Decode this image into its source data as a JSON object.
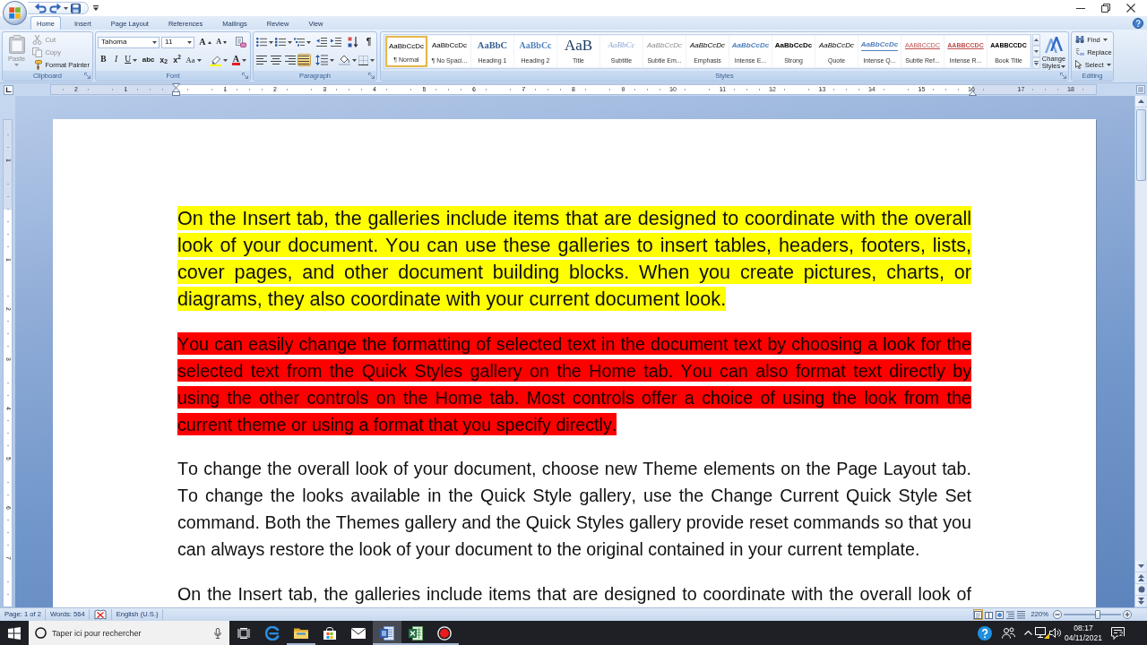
{
  "ribbon": {
    "tabs": [
      {
        "label": "Home",
        "selected": true
      },
      {
        "label": "Insert",
        "selected": false
      },
      {
        "label": "Page Layout",
        "selected": false
      },
      {
        "label": "References",
        "selected": false
      },
      {
        "label": "Mailings",
        "selected": false
      },
      {
        "label": "Review",
        "selected": false
      },
      {
        "label": "View",
        "selected": false
      }
    ],
    "clipboard": {
      "title": "Clipboard",
      "paste": {
        "label": "Paste",
        "disabled": true
      },
      "commands": [
        {
          "kind": "cut",
          "label": "Cut",
          "disabled": true
        },
        {
          "kind": "copy",
          "label": "Copy",
          "disabled": true
        },
        {
          "kind": "format_painter",
          "label": "Format Painter",
          "disabled": false
        }
      ]
    },
    "font": {
      "title": "Font",
      "font_name": "Tahoma",
      "font_size": "11",
      "size_buttons": [
        {
          "kind": "grow",
          "label": "A"
        },
        {
          "kind": "shrink",
          "label": "A"
        }
      ],
      "format_buttons": [
        {
          "kind": "bold",
          "label": "B"
        },
        {
          "kind": "italic",
          "label": "I"
        },
        {
          "kind": "underline",
          "label": "U"
        },
        {
          "kind": "strikethrough",
          "label": "abc"
        },
        {
          "kind": "subscript",
          "label": "x$_{2}$"
        },
        {
          "kind": "superscript",
          "label": "x$^{2}$"
        },
        {
          "kind": "change_case",
          "label": "Aa"
        }
      ],
      "font_color": {
        "label": "A"
      }
    },
    "paragraph": {
      "title": "Paragraph",
      "pilcrow": "¶",
      "alignment": [
        {
          "kind": "left",
          "selected": false
        },
        {
          "kind": "center",
          "selected": false
        },
        {
          "kind": "right",
          "selected": false
        },
        {
          "kind": "justify",
          "selected": true
        }
      ]
    },
    "styles": {
      "title": "Styles",
      "items": [
        {
          "kind": "normal",
          "preview": "AaBbCcDc",
          "label": "¶ Normal",
          "selected": true
        },
        {
          "kind": "no_spacing",
          "preview": "AaBbCcDc",
          "label": "¶ No Spaci...",
          "selected": false
        },
        {
          "kind": "heading1",
          "preview": "AaBbC",
          "label": "Heading 1",
          "selected": false
        },
        {
          "kind": "heading2",
          "preview": "AaBbCc",
          "label": "Heading 2",
          "selected": false
        },
        {
          "kind": "title",
          "preview": "AaB",
          "label": "Title",
          "selected": false
        },
        {
          "kind": "subtitle",
          "preview": "AaBbCc",
          "label": "Subtitle",
          "selected": false
        },
        {
          "kind": "subtle_emphasis",
          "preview": "AaBbCcDc",
          "label": "Subtle Em...",
          "selected": false
        },
        {
          "kind": "emphasis",
          "preview": "AaBbCcDc",
          "label": "Emphasis",
          "selected": false
        },
        {
          "kind": "intense_emphasis",
          "preview": "AaBbCcDc",
          "label": "Intense E...",
          "selected": false
        },
        {
          "kind": "strong",
          "preview": "AaBbCcDc",
          "label": "Strong",
          "selected": false
        },
        {
          "kind": "quote",
          "preview": "AaBbCcDc",
          "label": "Quote",
          "selected": false
        },
        {
          "kind": "intense_quote",
          "preview": "AaBbCcDc",
          "label": "Intense Q...",
          "selected": false
        },
        {
          "kind": "subtle_reference",
          "preview": "AABBCCDC",
          "label": "Subtle Ref...",
          "selected": false
        },
        {
          "kind": "intense_reference",
          "preview": "AABBCCDC",
          "label": "Intense R...",
          "selected": false
        },
        {
          "kind": "book_title",
          "preview": "AABBCCDC",
          "label": "Book Title",
          "selected": false
        }
      ],
      "change_styles": "Change Styles"
    },
    "editing": {
      "title": "Editing",
      "commands": [
        {
          "kind": "find",
          "label": "Find"
        },
        {
          "kind": "replace",
          "label": "Replace"
        },
        {
          "kind": "select",
          "label": "Select"
        }
      ]
    }
  },
  "rulers": {
    "horizontal": {
      "left_labels": [
        "2",
        "1"
      ],
      "labels": [
        "1",
        "2",
        "3",
        "4",
        "5",
        "6",
        "7",
        "8",
        "9",
        "10",
        "11",
        "12",
        "13",
        "14",
        "15",
        "16",
        "17",
        "18"
      ]
    },
    "vertical": {
      "top_labels": [
        "1"
      ],
      "labels": [
        "1",
        "2",
        "3",
        "4",
        "5",
        "6",
        "7"
      ]
    }
  },
  "document": {
    "paragraphs": [
      {
        "text": "On the Insert tab, the galleries include items that are designed to coordinate with the overall look of your document. You can use these galleries to insert tables, headers, footers, lists, cover pages, and other document building blocks. When you create pictures, charts, or diagrams, they also coordinate with your current document look.",
        "color": "#ffff00"
      },
      {
        "text": "You can easily change the formatting of selected text in the document text by choosing a look for the selected text from the Quick Styles gallery on the Home tab. You can also format text directly by using the other controls on the Home tab. Most controls offer a choice of using the look from the current theme or using a format that you specify directly.",
        "color": "#ff0000"
      },
      {
        "text": "To change the overall look of your document, choose new Theme elements on the Page Layout tab. To change the looks available in the Quick Style gallery, use the Change Current Quick Style Set command. Both the Themes gallery and the Quick Styles gallery provide reset commands so that you can always restore the look of your document to the original contained in your current template."
      },
      {
        "text": "On the Insert tab, the galleries include items that are designed to coordinate with the overall look of"
      }
    ]
  },
  "status_bar": {
    "page": "Page: 1 of 2",
    "words": "Words: 564",
    "language": "English (U.S.)",
    "views": [
      {
        "kind": "print_layout",
        "selected": true
      },
      {
        "kind": "full_screen_reading",
        "selected": false
      },
      {
        "kind": "web_layout",
        "selected": false
      },
      {
        "kind": "outline",
        "selected": false
      },
      {
        "kind": "draft",
        "selected": false
      }
    ],
    "zoom": "220%",
    "zoom_slider": {
      "level": 0.6
    }
  },
  "taskbar": {
    "search": {
      "placeholder": "Taper ici pour rechercher"
    },
    "apps": [
      {
        "kind": "task_view",
        "running": false,
        "selected": false
      },
      {
        "kind": "edge",
        "running": false,
        "selected": false
      },
      {
        "kind": "explorer",
        "running": true,
        "selected": false
      },
      {
        "kind": "store",
        "running": false,
        "selected": false
      },
      {
        "kind": "mail",
        "running": false,
        "selected": false
      },
      {
        "kind": "word",
        "running": true,
        "selected": true
      },
      {
        "kind": "excel",
        "running": true,
        "selected": false
      },
      {
        "kind": "recorder",
        "running": true,
        "selected": false
      }
    ],
    "time": "08:17",
    "date": "04/11/2021",
    "notifications": "2"
  }
}
